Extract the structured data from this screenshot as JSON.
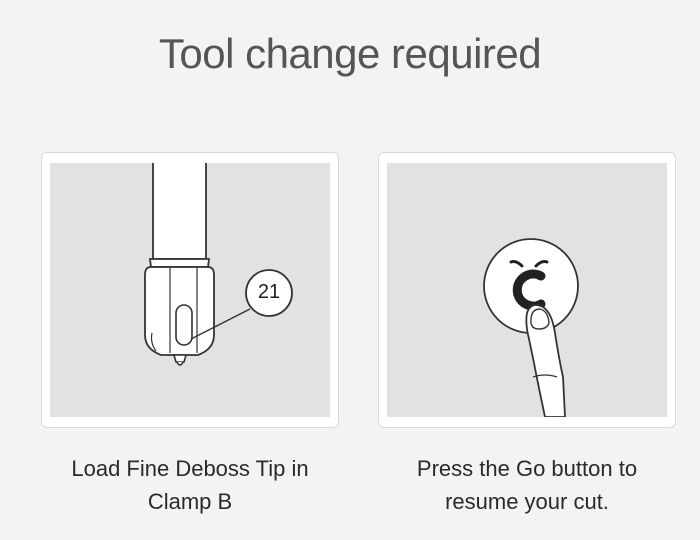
{
  "dialog": {
    "title": "Tool change required"
  },
  "steps": [
    {
      "badge_number": "21",
      "caption_line1": "Load Fine Deboss Tip in",
      "caption_line2": "Clamp B",
      "illustration": "fine-deboss-tip-icon"
    },
    {
      "caption_line1": "Press the Go button to",
      "caption_line2": "resume your cut.",
      "illustration": "press-go-button-icon",
      "button_icon": "cricut-c-logo-icon"
    }
  ],
  "colors": {
    "background": "#f3f3f4",
    "card": "#ffffff",
    "illustration_bg": "#e2e2e2",
    "line_art": "#333333"
  }
}
